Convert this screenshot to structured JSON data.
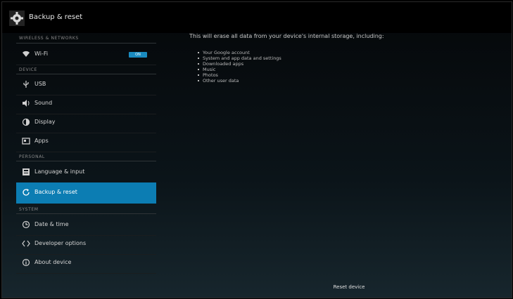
{
  "app": {
    "title": "Backup & reset"
  },
  "sidebar": {
    "sections": [
      {
        "header": "WIRELESS & NETWORKS"
      },
      {
        "header": "DEVICE"
      },
      {
        "header": "PERSONAL"
      },
      {
        "header": "SYSTEM"
      }
    ],
    "items": [
      {
        "label": "Wi-Fi",
        "icon": "wifi-icon",
        "toggle": "ON"
      },
      {
        "label": "USB",
        "icon": "usb-icon"
      },
      {
        "label": "Sound",
        "icon": "sound-icon"
      },
      {
        "label": "Display",
        "icon": "display-icon"
      },
      {
        "label": "Apps",
        "icon": "apps-icon"
      },
      {
        "label": "Language & input",
        "icon": "language-icon"
      },
      {
        "label": "Backup & reset",
        "icon": "backup-icon",
        "selected": true
      },
      {
        "label": "Date & time",
        "icon": "clock-icon"
      },
      {
        "label": "Developer options",
        "icon": "developer-icon"
      },
      {
        "label": "About device",
        "icon": "info-icon"
      }
    ]
  },
  "content": {
    "intro": "This will erase all data from your device's internal storage, including:",
    "bullets": [
      "Your Google account",
      "System and app data and settings",
      "Downloaded apps",
      "Music",
      "Photos",
      "Other user data"
    ],
    "reset_button": "Reset device"
  },
  "colors": {
    "accent": "#0c7db3",
    "toggle_on": "#1a8bc0"
  }
}
